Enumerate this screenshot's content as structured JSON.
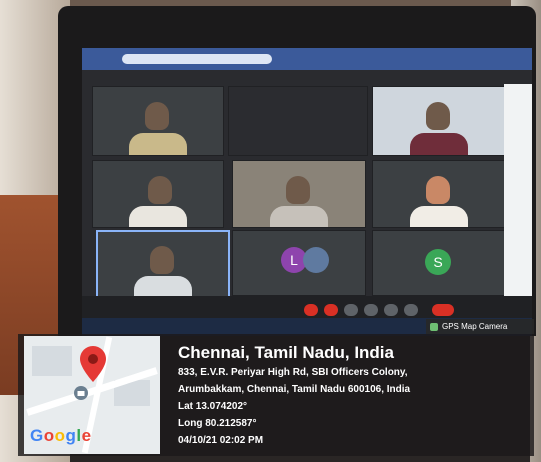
{
  "overlay": {
    "badge_label": "GPS Map Camera",
    "location_title": "Chennai, Tamil Nadu, India",
    "address_line1": "833, E.V.R. Periyar High Rd, SBI Officers Colony,",
    "address_line2": "Arumbakkam, Chennai, Tamil Nadu 600106, India",
    "lat": "Lat 13.074202°",
    "long": "Long 80.212587°",
    "datetime": "04/10/21 02:02 PM",
    "map_logo": "Google"
  },
  "meeting": {
    "avatars": [
      {
        "letter": "L",
        "color": "#8e44ad"
      },
      {
        "letter": "S",
        "color": "#3aa757"
      }
    ]
  },
  "colors": {
    "pin": "#e53935",
    "overlay_bg": "#1c1a1b"
  }
}
